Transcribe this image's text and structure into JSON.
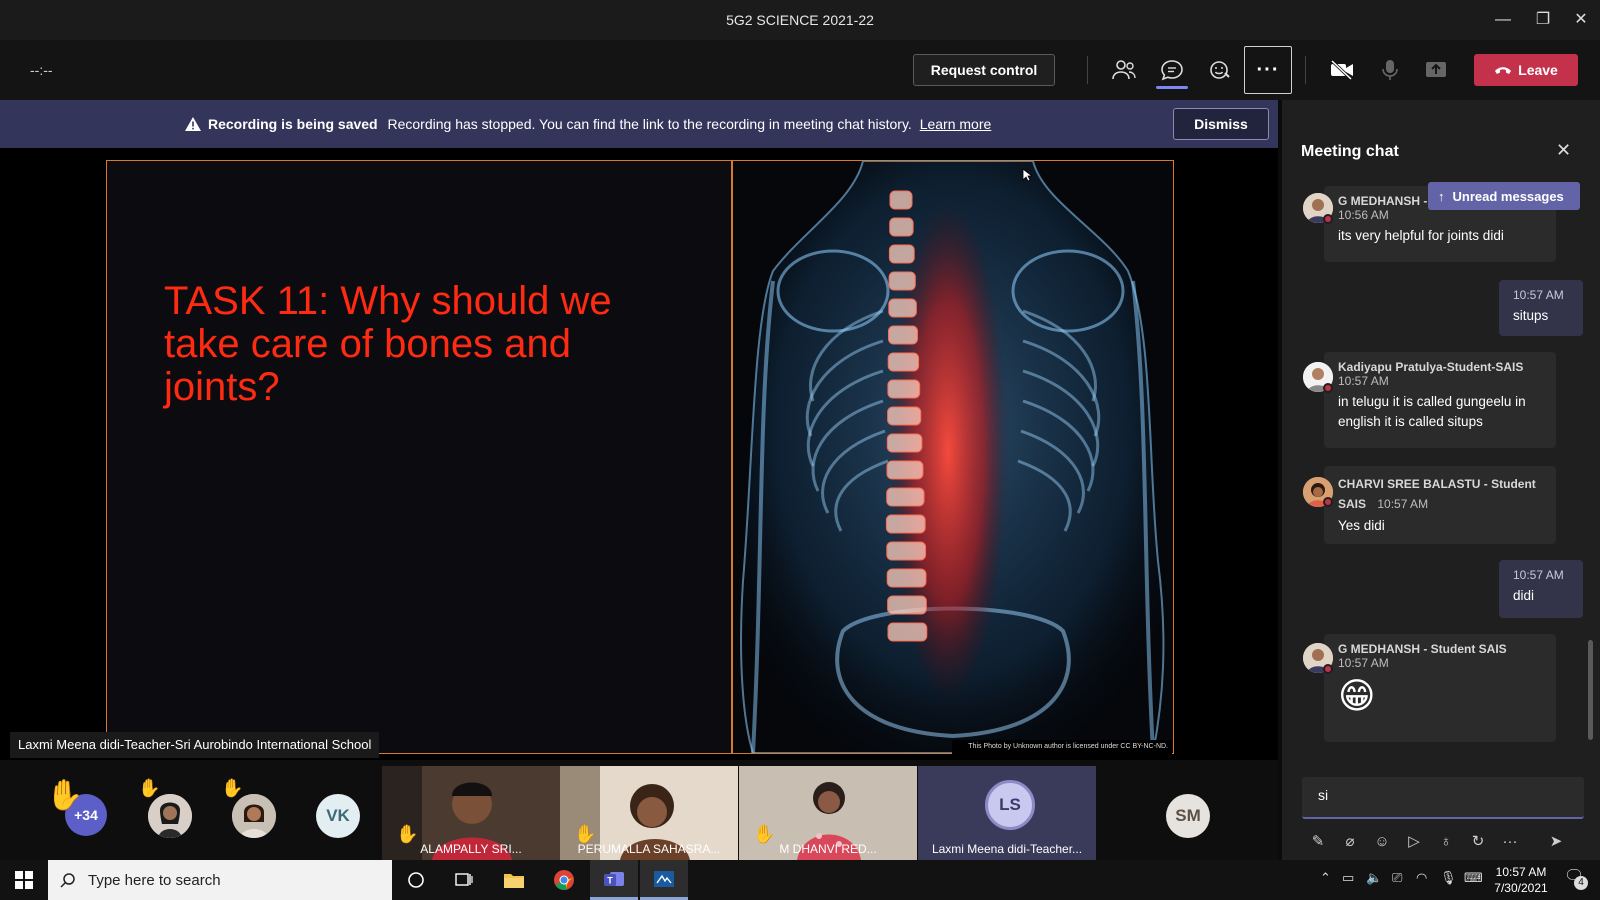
{
  "window": {
    "title": "5G2 SCIENCE 2021-22"
  },
  "toolbar": {
    "timer": "--:--",
    "request_control_label": "Request control",
    "leave_label": "Leave"
  },
  "banner": {
    "bold_text": "Recording is being saved",
    "text": "Recording has stopped. You can find the link to the recording in meeting chat history.",
    "link_text": "Learn more",
    "dismiss_label": "Dismiss"
  },
  "slide": {
    "title": "TASK 11: Why should we take care of bones and joints?",
    "credit": "This Photo by Unknown author is licensed under CC BY-NC-ND."
  },
  "presenter_label": "Laxmi Meena didi-Teacher-Sri Aurobindo International School",
  "participants": {
    "overflow_count": "+34",
    "avatars": [
      "VK",
      "SM",
      "LS"
    ],
    "tiles": [
      {
        "name": "ALAMPALLY SRI..."
      },
      {
        "name": "PERUMALLA SAHASRA..."
      },
      {
        "name": "M DHANVI RED..."
      },
      {
        "name": "Laxmi Meena didi-Teacher..."
      }
    ]
  },
  "chat": {
    "title": "Meeting chat",
    "unread_label": "Unread messages",
    "messages": [
      {
        "sender": "G MEDHANSH -",
        "time": "10:56 AM",
        "body": "its very helpful for joints didi"
      },
      {
        "time": "10:57 AM",
        "body": "situps"
      },
      {
        "sender": "Kadiyapu Pratulya-Student-SAIS",
        "time": "10:57 AM",
        "body": "in telugu it is called gungeelu in english it is called situps"
      },
      {
        "sender": "CHARVI SREE BALASTU - Student SAIS",
        "time": "10:57 AM",
        "body": "Yes didi"
      },
      {
        "time": "10:57 AM",
        "body": "didi"
      },
      {
        "sender": "G MEDHANSH - Student SAIS",
        "time": "10:57 AM",
        "body": "😁"
      }
    ],
    "compose_value": "si"
  },
  "taskbar": {
    "search_placeholder": "Type here to search",
    "time": "10:57 AM",
    "date": "7/30/2021",
    "notifications": "4"
  },
  "colors": {
    "leave": "#c4314b",
    "accent": "#6264a7",
    "slide_title": "#ff2a12",
    "slide_border": "#d77a2f"
  }
}
